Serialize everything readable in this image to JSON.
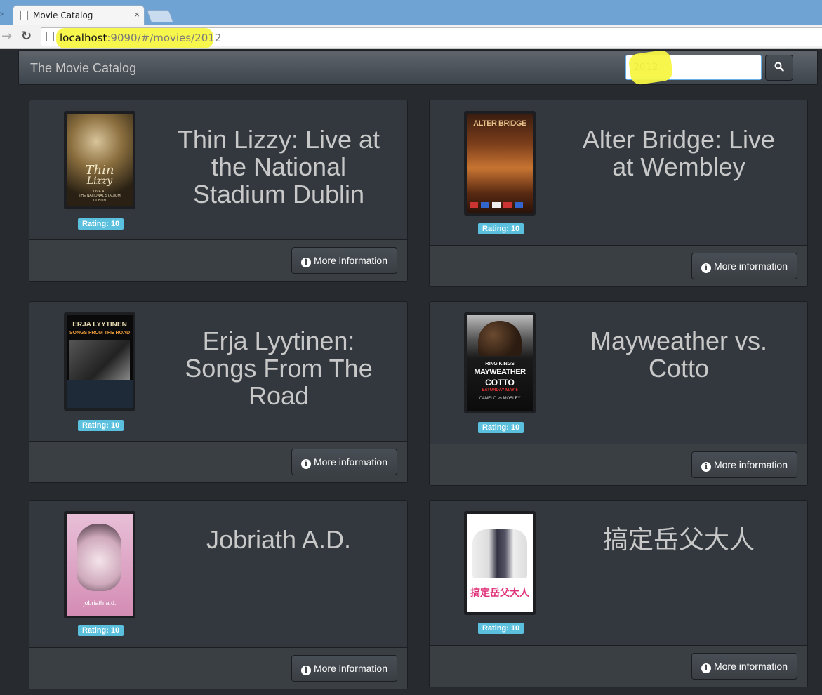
{
  "browser": {
    "tab_title": "Movie Catalog",
    "tab_close": "×",
    "url_host": "localhost",
    "url_rest": ":9090/#/movies/2012"
  },
  "navbar": {
    "brand": "The Movie Catalog",
    "search_value": "2012"
  },
  "movies": [
    {
      "title": "Thin Lizzy: Live at the National Stadium Dublin",
      "rating": "Rating: 10",
      "button": "More information"
    },
    {
      "title": "Alter Bridge: Live at Wembley",
      "rating": "Rating: 10",
      "button": "More information"
    },
    {
      "title": "Erja Lyytinen: Songs From The Road",
      "rating": "Rating: 10",
      "button": "More information"
    },
    {
      "title": "Mayweather vs. Cotto",
      "rating": "Rating: 10",
      "button": "More information"
    },
    {
      "title": "Jobriath A.D.",
      "rating": "Rating: 10",
      "button": "More information"
    },
    {
      "title": "搞定岳父大人",
      "rating": "Rating: 10",
      "button": "More information"
    }
  ],
  "posters": {
    "thin": {
      "line1": "Thin",
      "line2": "Lizzy",
      "line3": "LIVE AT",
      "line4": "THE NATIONAL STADIUM",
      "line5": "DUBLIN"
    },
    "alter": {
      "line1": "ALTER BRIDGE"
    },
    "erja": {
      "line1": "ERJA LYYTINEN",
      "line2": "SONGS FROM THE ROAD"
    },
    "may": {
      "line1": "RING KINGS",
      "line2": "MAYWEATHER",
      "line3": "COTTO",
      "line4": "SATURDAY MAY 5",
      "line5": "CANELO vs MOSLEY"
    },
    "job": {
      "line1": "jobriath a.d."
    },
    "zh": {
      "line1": "搞定岳父大人"
    }
  },
  "colors": {
    "accent": "#5bc0de",
    "background": "#272b30",
    "card": "#32383e",
    "highlight": "#f7f542"
  },
  "icons": {
    "search": "search-icon",
    "info": "info-icon"
  }
}
